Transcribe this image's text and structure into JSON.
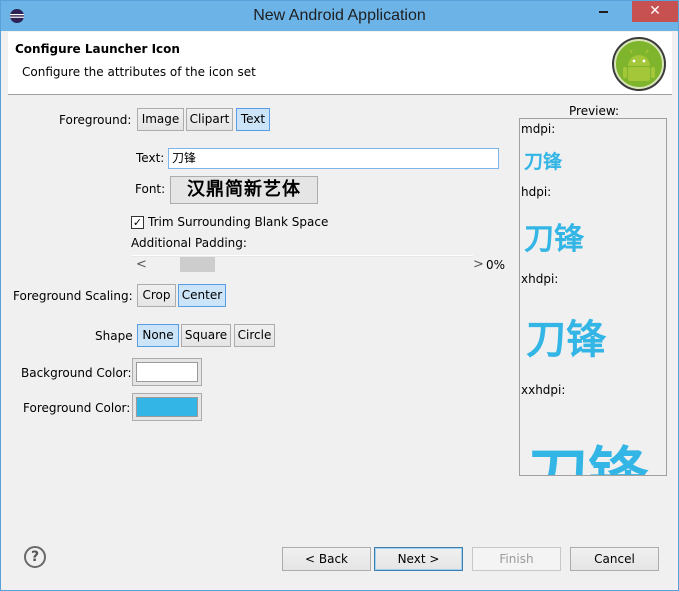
{
  "window": {
    "title": "New Android Application",
    "close_glyph": "✕"
  },
  "header": {
    "title": "Configure Launcher Icon",
    "description": "Configure the attributes of the icon set"
  },
  "foreground": {
    "label": "Foreground:",
    "options": [
      "Image",
      "Clipart",
      "Text"
    ],
    "selected": "Text"
  },
  "text_field": {
    "label": "Text:",
    "value": "刀锋"
  },
  "font_field": {
    "label": "Font:",
    "value": "汉鼎简新艺体"
  },
  "trim": {
    "label": "Trim Surrounding Blank Space",
    "checked": true,
    "check_glyph": "✓"
  },
  "padding": {
    "label": "Additional Padding:",
    "left_arrow": "<",
    "right_arrow": ">",
    "value": "0%"
  },
  "scaling": {
    "label": "Foreground Scaling:",
    "options": [
      "Crop",
      "Center"
    ],
    "selected": "Center"
  },
  "shape": {
    "label": "Shape",
    "options": [
      "None",
      "Square",
      "Circle"
    ],
    "selected": "None"
  },
  "background_color": {
    "label": "Background Color:",
    "value": "#ffffff"
  },
  "foreground_color": {
    "label": "Foreground Color:",
    "value": "#33b5e5"
  },
  "preview": {
    "label": "Preview:",
    "densities": [
      "mdpi:",
      "hdpi:",
      "xhdpi:",
      "xxhdpi:"
    ],
    "glyph_text": "刀锋"
  },
  "footer": {
    "help_glyph": "?",
    "back": "< Back",
    "next": "Next >",
    "finish": "Finish",
    "cancel": "Cancel"
  }
}
